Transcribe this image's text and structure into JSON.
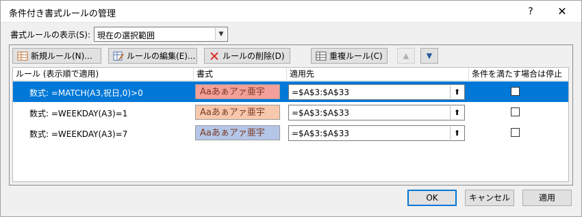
{
  "window": {
    "title": "条件付き書式ルールの管理",
    "help": "?",
    "close": "✕"
  },
  "scope": {
    "label": "書式ルールの表示(S):",
    "value": "現在の選択範囲"
  },
  "toolbar": {
    "new_rule": "新規ルール(N)...",
    "edit_rule": "ルールの編集(E)...",
    "delete_rule": "ルールの削除(D)",
    "duplicate_rule": "重複ルール(C)",
    "move_up": "▲",
    "move_down": "▼"
  },
  "columns": {
    "rule": "ルール (表示順で適用)",
    "format": "書式",
    "applies_to": "適用先",
    "stop_if_true": "条件を満たす場合は停止"
  },
  "rules": [
    {
      "rule": "数式: =MATCH(A3,祝日,0)>0",
      "preview": "Aaあぁアァ亜宇",
      "preview_bg": "#f4a09a",
      "applies_to": "=$A$3:$A$33",
      "stop": false,
      "selected": true
    },
    {
      "rule": "数式: =WEEKDAY(A3)=1",
      "preview": "Aaあぁアァ亜宇",
      "preview_bg": "#f8c8ae",
      "applies_to": "=$A$3:$A$33",
      "stop": false,
      "selected": false
    },
    {
      "rule": "数式: =WEEKDAY(A3)=7",
      "preview": "Aaあぁアァ亜宇",
      "preview_bg": "#b4c6e8",
      "applies_to": "=$A$3:$A$33",
      "stop": false,
      "selected": false
    }
  ],
  "buttons": {
    "ok": "OK",
    "cancel": "キャンセル",
    "apply": "適用"
  },
  "colors": {
    "selection": "#0078d7",
    "default_button_border": "#0078d7"
  }
}
